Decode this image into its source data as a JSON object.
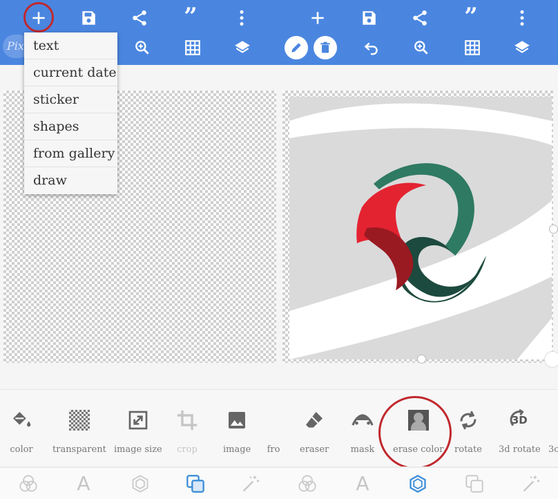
{
  "brand": {
    "logo_text": "Pix"
  },
  "menu": {
    "items": [
      "text",
      "current date",
      "sticker",
      "shapes",
      "from gallery",
      "draw"
    ]
  },
  "top_icons": {
    "quote_left": "”",
    "quote_right": "”"
  },
  "tools": [
    {
      "label": "color",
      "icon": "paint-bucket-icon"
    },
    {
      "label": "transparent",
      "icon": "transparent-grid-icon"
    },
    {
      "label": "image size",
      "icon": "resize-icon"
    },
    {
      "label": "crop",
      "icon": "crop-icon",
      "disabled": true
    },
    {
      "label": "image",
      "icon": "image-icon"
    },
    {
      "label": "fro",
      "icon": ""
    },
    {
      "label": "eraser",
      "icon": "eraser-icon"
    },
    {
      "label": "mask",
      "icon": "mask-icon"
    },
    {
      "label": "erase color",
      "icon": "erase-color-icon"
    },
    {
      "label": "rotate",
      "icon": "rotate-icon"
    },
    {
      "label": "3d rotate",
      "icon": "3d-rotate-icon",
      "badge": "3D"
    },
    {
      "label": "3c",
      "icon": ""
    }
  ],
  "bottom_tabs": {
    "text_letter_left": "A",
    "text_letter_right": "A"
  },
  "colors": {
    "topbar": "#4a86e0",
    "highlight_ring": "#c0282d",
    "logo_green": "#2e7a62",
    "logo_dark_green": "#1d4a3e",
    "logo_red": "#e42331",
    "logo_dark_red": "#9a1a22",
    "active_tab": "#3d8ed8"
  }
}
